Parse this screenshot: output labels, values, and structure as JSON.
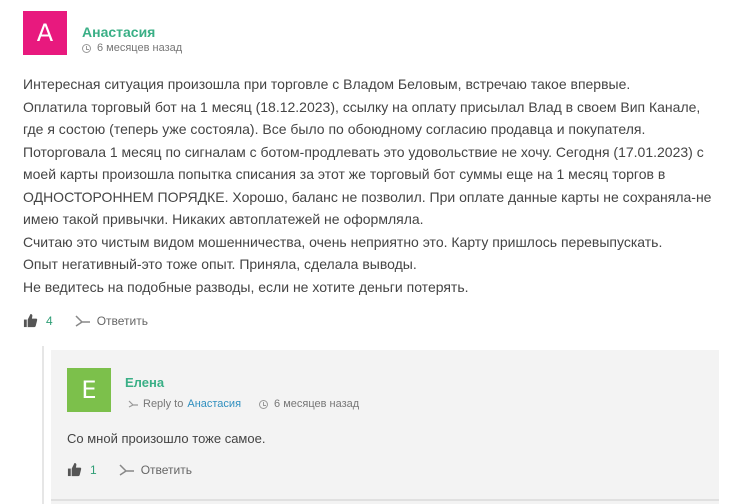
{
  "comment": {
    "avatar_letter": "А",
    "author": "Анастасия",
    "time": "6 месяцев назад",
    "lines": [
      "Интересная ситуация произошла при торговле с Владом Беловым, встречаю такое впервые.",
      "Оплатила торговый бот на 1 месяц (18.12.2023), ссылку на оплату присылал Влад в своем Вип Канале,",
      "где я состою (теперь уже состояла). Все было по обоюдному согласию продавца и покупателя.",
      "Поторговала 1 месяц по сигналам с ботом-продлевать это удовольствие не хочу. Сегодня (17.01.2023) с",
      "моей карты произошла попытка списания за этот же торговый бот суммы еще на 1 месяц торгов в",
      "ОДНОСТОРОННЕМ ПОРЯДКЕ. Хорошо, баланс не позволил. При оплате данные карты не сохраняла-не",
      "имею такой привычки. Никаких автоплатежей не оформляла.",
      "Считаю это чистым видом мошенничества, очень неприятно это. Карту пришлось перевыпускать.",
      "Опыт негативный-это тоже опыт. Приняла, сделала выводы.",
      "Не ведитесь на подобные разводы, если не хотите деньги потерять."
    ],
    "likes": "4",
    "reply_label": "Ответить",
    "avatar_color": "#e8197e"
  },
  "reply": {
    "avatar_letter": "E",
    "author": "Елена",
    "reply_to_label": "Reply to",
    "reply_to_name": "Анастасия",
    "time": "6 месяцев назад",
    "text": "Со мной произошло тоже самое.",
    "likes": "1",
    "reply_label": "Ответить",
    "avatar_color": "#7cc04b"
  },
  "icons": {
    "thumbs_up": "thumbs-up-icon",
    "reply": "reply-arrow-icon",
    "clock": "clock-icon"
  },
  "colors": {
    "author": "#3aaf86",
    "link": "#2f8fbf"
  }
}
